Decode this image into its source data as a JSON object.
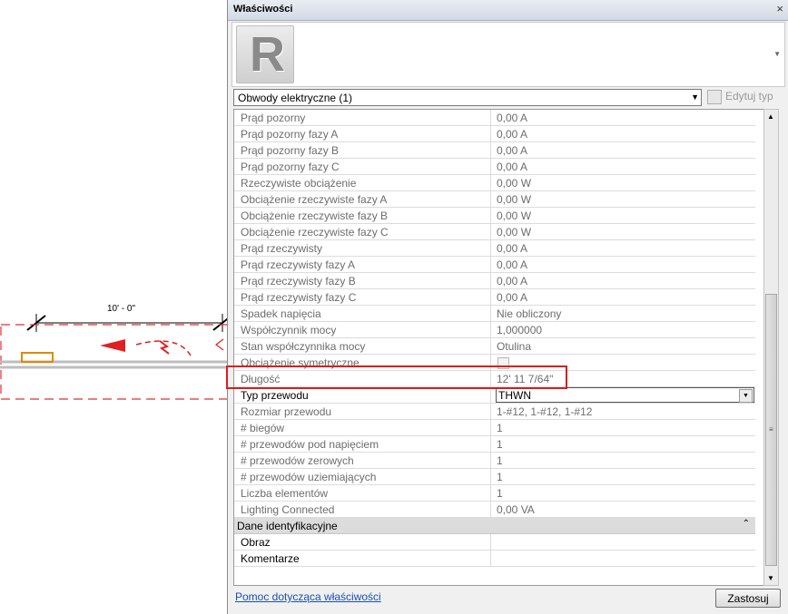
{
  "drawing": {
    "dimension_label": "10' - 0\""
  },
  "panel": {
    "title": "Właściwości",
    "close_glyph": "×",
    "logo_letter": "R",
    "type_selector": "Obwody elektryczne (1)",
    "edit_type": "Edytuj typ",
    "help_link": "Pomoc dotycząca właściwości",
    "apply": "Zastosuj"
  },
  "rows": [
    {
      "name": "Prąd pozorny",
      "value": "0,00 A"
    },
    {
      "name": "Prąd pozorny fazy A",
      "value": "0,00 A"
    },
    {
      "name": "Prąd pozorny fazy B",
      "value": "0,00 A"
    },
    {
      "name": "Prąd pozorny fazy C",
      "value": "0,00 A"
    },
    {
      "name": "Rzeczywiste obciążenie",
      "value": "0,00 W"
    },
    {
      "name": "Obciążenie rzeczywiste fazy A",
      "value": "0,00 W"
    },
    {
      "name": "Obciążenie rzeczywiste fazy B",
      "value": "0,00 W"
    },
    {
      "name": "Obciążenie rzeczywiste fazy C",
      "value": "0,00 W"
    },
    {
      "name": "Prąd rzeczywisty",
      "value": "0,00 A"
    },
    {
      "name": "Prąd rzeczywisty fazy A",
      "value": "0,00 A"
    },
    {
      "name": "Prąd rzeczywisty fazy B",
      "value": "0,00 A"
    },
    {
      "name": "Prąd rzeczywisty fazy C",
      "value": "0,00 A"
    },
    {
      "name": "Spadek napięcia",
      "value": "Nie obliczony"
    },
    {
      "name": "Współczynnik mocy",
      "value": "1,000000"
    },
    {
      "name": "Stan współczynnika mocy",
      "value": "Otulina"
    },
    {
      "name": "Obciążenie symetryczne",
      "value": ""
    },
    {
      "name": "Długość",
      "value": "12'  11 7/64\""
    },
    {
      "name": "Typ przewodu",
      "value": "THWN"
    },
    {
      "name": "Rozmiar przewodu",
      "value": "1-#12, 1-#12, 1-#12"
    },
    {
      "name": "# biegów",
      "value": "1"
    },
    {
      "name": "# przewodów pod napięciem",
      "value": "1"
    },
    {
      "name": "# przewodów zerowych",
      "value": "1"
    },
    {
      "name": "# przewodów uziemiających",
      "value": "1"
    },
    {
      "name": "Liczba elementów",
      "value": "1"
    },
    {
      "name": "Lighting Connected",
      "value": "0,00 VA"
    }
  ],
  "group": {
    "name": "Dane identyfikacyjne",
    "toggle": "⌃",
    "rows": [
      {
        "name": "Obraz",
        "value": ""
      },
      {
        "name": "Komentarze",
        "value": ""
      }
    ]
  }
}
